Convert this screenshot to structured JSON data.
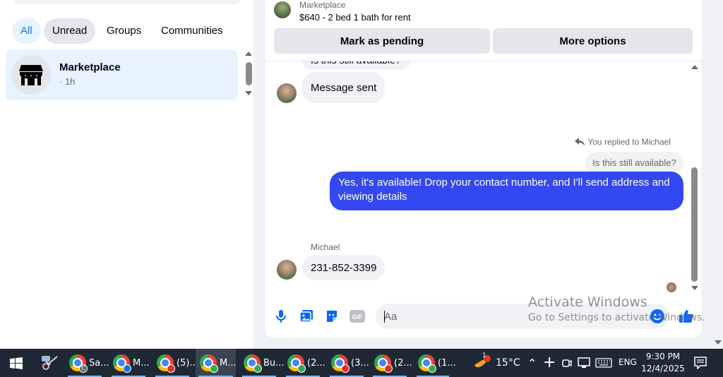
{
  "sidebar": {
    "filters": [
      "All",
      "Unread",
      "Groups",
      "Communities"
    ],
    "conversation": {
      "title": "Marketplace",
      "meta": "· 1h"
    }
  },
  "chat": {
    "header": {
      "source": "Marketplace",
      "title": "$640 - 2 bed 1 bath for rent"
    },
    "actions": {
      "mark_pending": "Mark as pending",
      "more_options": "More options"
    },
    "messages": {
      "partial_top": "Is this still available?",
      "incoming_1": "Message sent",
      "reply_label": "You replied to Michael",
      "quoted": "Is this still available?",
      "outgoing": "Yes, it's available! Drop your contact number, and I'll send address and viewing details",
      "sender": "Michael",
      "incoming_2": "231-852-3399"
    },
    "composer": {
      "placeholder": "Aa"
    }
  },
  "watermark": {
    "line1": "Activate Windows",
    "line2": "Go to Settings to activate Windows."
  },
  "taskbar": {
    "items": [
      {
        "label": "Sa...",
        "badge": "C",
        "badge_color": "#5f6368",
        "active": false
      },
      {
        "label": "M...",
        "badge": "",
        "badge_color": "#1a73e8",
        "active": false
      },
      {
        "label": "(5)...",
        "badge": "",
        "badge_color": "#d93025",
        "active": false
      },
      {
        "label": "M...",
        "badge": "",
        "badge_color": "#34a853",
        "active": true
      },
      {
        "label": "Bu...",
        "badge": "",
        "badge_color": "#34a853",
        "active": false
      },
      {
        "label": "(2...",
        "badge": "",
        "badge_color": "#34a853",
        "active": false
      },
      {
        "label": "(3...",
        "badge": "",
        "badge_color": "#d93025",
        "active": false
      },
      {
        "label": "(2...",
        "badge": "",
        "badge_color": "#d93025",
        "active": false
      },
      {
        "label": "(1...",
        "badge": "",
        "badge_color": "#34a853",
        "active": false
      }
    ],
    "weather": {
      "badge": "1",
      "temp": "15°C"
    },
    "language": "ENG",
    "time": "9:30 PM",
    "date": "12/4/2025"
  },
  "colors": {
    "accent": "#1877f2",
    "outgoing_bubble": "#3348f0",
    "taskbar": "#1f2935"
  }
}
